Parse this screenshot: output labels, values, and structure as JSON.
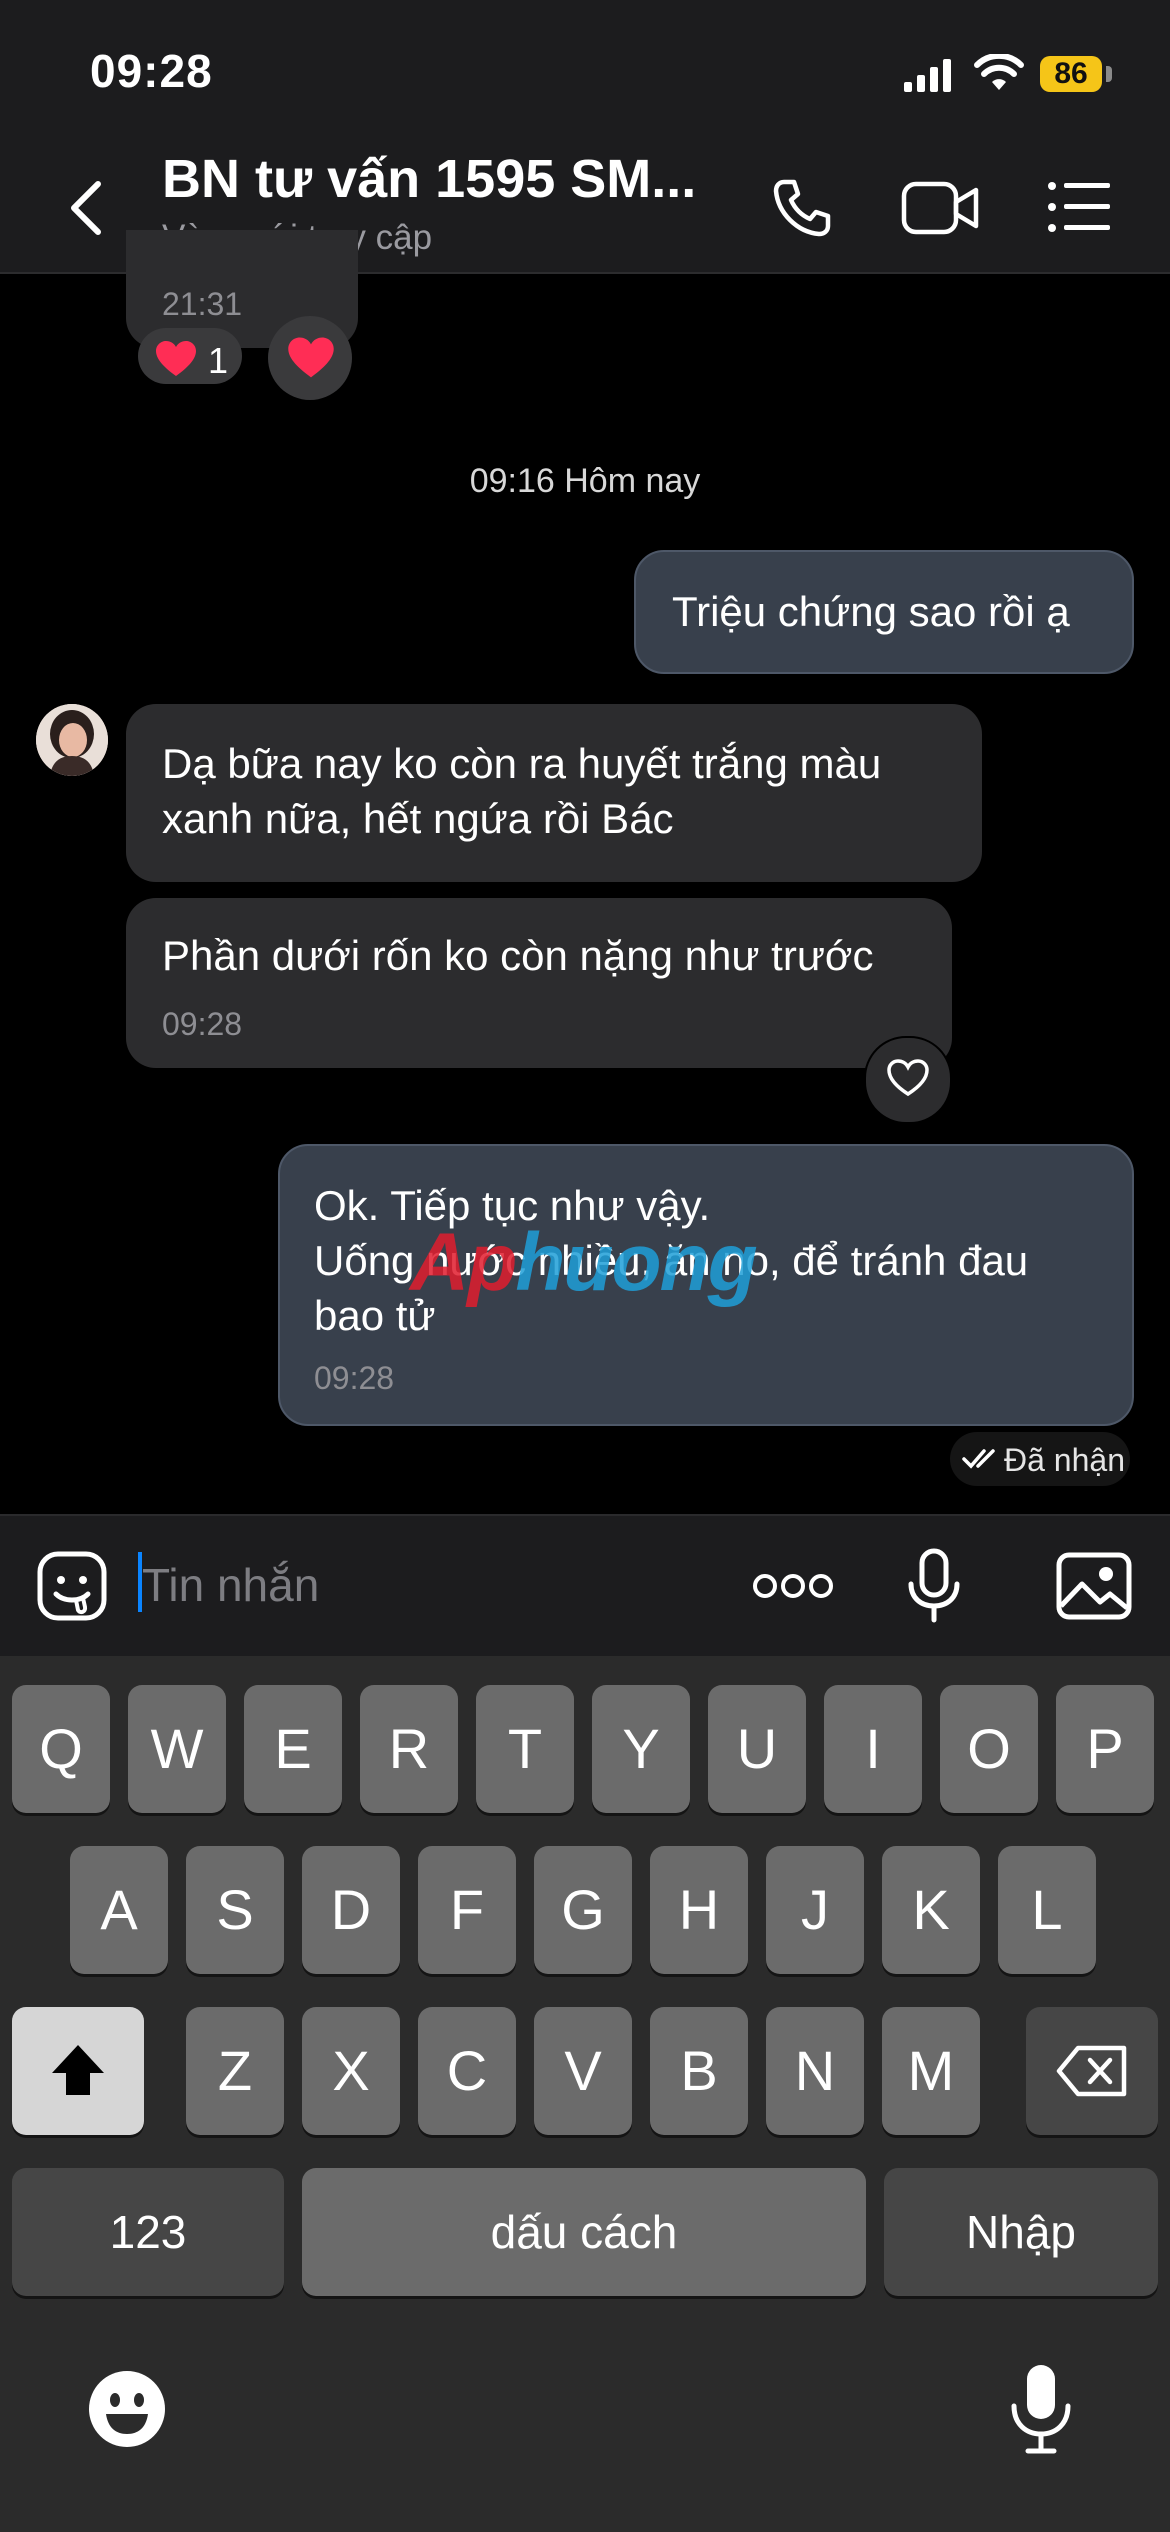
{
  "status_bar": {
    "time": "09:28",
    "battery": "86"
  },
  "header": {
    "title": "BN tư vấn 1595 SM...",
    "subtitle": "Vừa mới truy cập"
  },
  "chat": {
    "prev_message_time": "21:31",
    "prev_reaction_count": "1",
    "date_separator": "09:16 Hôm nay",
    "messages": [
      {
        "from": "me",
        "text": "Triệu chứng sao rồi ạ"
      },
      {
        "from": "other",
        "text": "Dạ bữa nay ko còn ra huyết trắng màu xanh nữa, hết ngứa rồi Bác"
      },
      {
        "from": "other",
        "text": "Phần dưới rốn ko còn nặng như trước",
        "time": "09:28"
      },
      {
        "from": "me",
        "text": "Ok. Tiếp tục như vậy.\nUống nước nhiều, ăn no, để tránh đau bao tử",
        "time": "09:28"
      }
    ],
    "delivery_status": "Đã nhận",
    "watermark": "Aphuong"
  },
  "input": {
    "placeholder": "Tin nhắn"
  },
  "keyboard": {
    "row1": [
      "Q",
      "W",
      "E",
      "R",
      "T",
      "Y",
      "U",
      "I",
      "O",
      "P"
    ],
    "row2": [
      "A",
      "S",
      "D",
      "F",
      "G",
      "H",
      "J",
      "K",
      "L"
    ],
    "row3": [
      "Z",
      "X",
      "C",
      "V",
      "B",
      "N",
      "M"
    ],
    "numbers_key": "123",
    "space_key": "dấu cách",
    "return_key": "Nhập"
  },
  "colors": {
    "accent": "#0a84ff",
    "battery": "#f5c518",
    "my_bubble": "#38404c",
    "their_bubble": "#2c2c2e",
    "heart": "#ff2d55"
  },
  "icons": [
    "back-icon",
    "phone-icon",
    "video-call-icon",
    "menu-icon",
    "heart-icon",
    "sticker-icon",
    "more-icon",
    "mic-icon",
    "image-icon",
    "shift-icon",
    "backspace-icon",
    "emoji-icon",
    "dictation-icon",
    "double-check-icon"
  ]
}
